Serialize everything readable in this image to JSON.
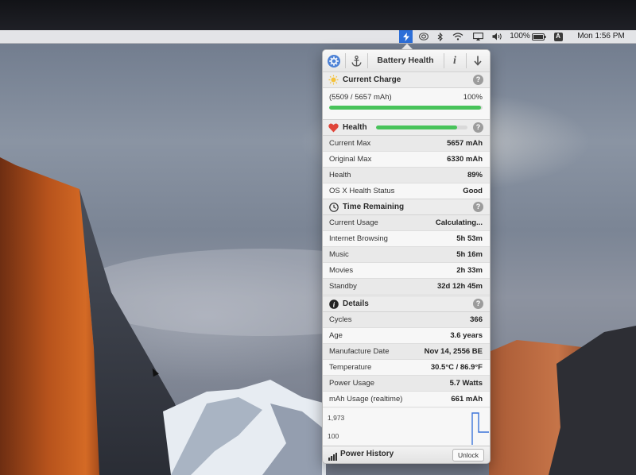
{
  "menubar": {
    "battery_percent": "100%",
    "clock": "Mon 1:56 PM",
    "input_source": "A",
    "icons": [
      "bolt-icon",
      "target-icon",
      "bluetooth-icon",
      "wifi-icon",
      "airplay-icon",
      "volume-icon",
      "battery-icon"
    ],
    "active_color": "#2d6fd8"
  },
  "popover": {
    "title": "Battery Health",
    "current_charge": {
      "title": "Current Charge",
      "mah_text": "(5509 / 5657 mAh)",
      "percent": "100%",
      "fill_fraction": 0.99
    },
    "health": {
      "title": "Health",
      "fill_fraction": 0.89,
      "rows": [
        {
          "label": "Current Max",
          "value": "5657 mAh"
        },
        {
          "label": "Original Max",
          "value": "6330 mAh"
        },
        {
          "label": "Health",
          "value": "89%"
        },
        {
          "label": "OS X Health Status",
          "value": "Good"
        }
      ]
    },
    "time_remaining": {
      "title": "Time Remaining",
      "rows": [
        {
          "label": "Current Usage",
          "value": "Calculating..."
        },
        {
          "label": "Internet Browsing",
          "value": "5h 53m"
        },
        {
          "label": "Music",
          "value": "5h 16m"
        },
        {
          "label": "Movies",
          "value": "2h 33m"
        },
        {
          "label": "Standby",
          "value": "32d 12h 45m"
        }
      ]
    },
    "details": {
      "title": "Details",
      "rows": [
        {
          "label": "Cycles",
          "value": "366"
        },
        {
          "label": "Age",
          "value": "3.6 years"
        },
        {
          "label": "Manufacture Date",
          "value": "Nov 14, 2556 BE"
        },
        {
          "label": "Temperature",
          "value": "30.5°C / 86.9°F"
        },
        {
          "label": "Power Usage",
          "value": "5.7 Watts"
        },
        {
          "label": "mAh Usage (realtime)",
          "value": "661 mAh"
        }
      ]
    },
    "graph": {
      "y_max_label": "1,973",
      "y_min_label": "100"
    },
    "footer": {
      "title": "Power History",
      "unlock_label": "Unlock"
    },
    "accent_green": "#48c35a",
    "heart_color": "#e0463a"
  }
}
